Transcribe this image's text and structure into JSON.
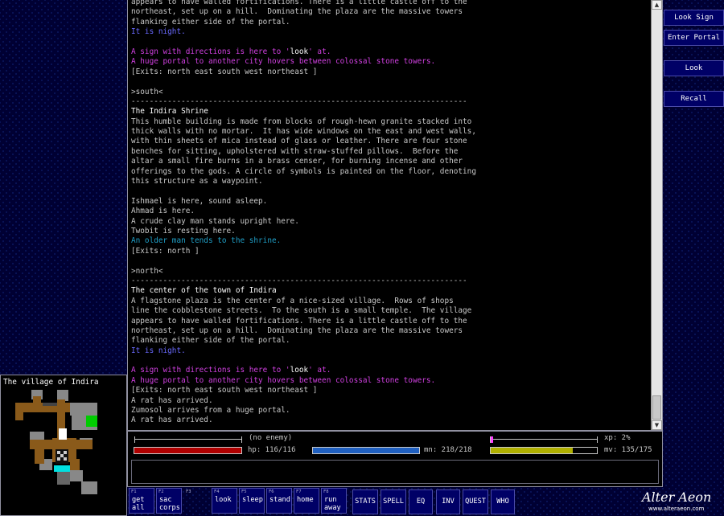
{
  "colors": {
    "text": "#c8c8c8",
    "title": "#ffffff",
    "night": "#6a6aff",
    "magenta": "#d040e0",
    "cyan": "#20a0c8",
    "command_highlight": "#ffffff",
    "hp": "#b00000",
    "mn": "#2060c0",
    "mv": "#b0b000",
    "xp": "#ff40ff"
  },
  "output_lines": [
    {
      "parts": [
        {
          "t": "appears to have walled fortifications. There is a little castle off to the",
          "c": "text"
        }
      ]
    },
    {
      "parts": [
        {
          "t": "northeast, set up on a hill.  Dominating the plaza are the massive towers",
          "c": "text"
        }
      ]
    },
    {
      "parts": [
        {
          "t": "flanking either side of the portal.",
          "c": "text"
        }
      ]
    },
    {
      "parts": [
        {
          "t": "It is night.",
          "c": "night"
        }
      ]
    },
    {
      "parts": [
        {
          "t": "",
          "c": "text"
        }
      ]
    },
    {
      "parts": [
        {
          "t": "A sign with directions is here to '",
          "c": "magenta"
        },
        {
          "t": "look",
          "c": "command_highlight"
        },
        {
          "t": "' at.",
          "c": "magenta"
        }
      ]
    },
    {
      "parts": [
        {
          "t": "A huge portal to another city hovers between colossal stone towers.",
          "c": "magenta"
        }
      ]
    },
    {
      "parts": [
        {
          "t": "[Exits: north east south west northeast ]",
          "c": "text"
        }
      ]
    },
    {
      "parts": [
        {
          "t": "",
          "c": "text"
        }
      ]
    },
    {
      "parts": [
        {
          "t": ">south<",
          "c": "text"
        }
      ]
    },
    {
      "parts": [
        {
          "t": "--------------------------------------------------------------------------",
          "c": "text"
        }
      ]
    },
    {
      "parts": [
        {
          "t": "The Indira Shrine",
          "c": "title"
        }
      ]
    },
    {
      "parts": [
        {
          "t": "This humble building is made from blocks of rough-hewn granite stacked into",
          "c": "text"
        }
      ]
    },
    {
      "parts": [
        {
          "t": "thick walls with no mortar.  It has wide windows on the east and west walls,",
          "c": "text"
        }
      ]
    },
    {
      "parts": [
        {
          "t": "with thin sheets of mica instead of glass or leather. There are four stone",
          "c": "text"
        }
      ]
    },
    {
      "parts": [
        {
          "t": "benches for sitting, upholstered with straw-stuffed pillows.  Before the",
          "c": "text"
        }
      ]
    },
    {
      "parts": [
        {
          "t": "altar a small fire burns in a brass censer, for burning incense and other",
          "c": "text"
        }
      ]
    },
    {
      "parts": [
        {
          "t": "offerings to the gods. A circle of symbols is painted on the floor, denoting",
          "c": "text"
        }
      ]
    },
    {
      "parts": [
        {
          "t": "this structure as a waypoint.",
          "c": "text"
        }
      ]
    },
    {
      "parts": [
        {
          "t": "",
          "c": "text"
        }
      ]
    },
    {
      "parts": [
        {
          "t": "Ishmael is here, sound asleep.",
          "c": "text"
        }
      ]
    },
    {
      "parts": [
        {
          "t": "Ahmad is here.",
          "c": "text"
        }
      ]
    },
    {
      "parts": [
        {
          "t": "A crude clay man stands upright here.",
          "c": "text"
        }
      ]
    },
    {
      "parts": [
        {
          "t": "Twobit is resting here.",
          "c": "text"
        }
      ]
    },
    {
      "parts": [
        {
          "t": "An older man tends to the shrine.",
          "c": "cyan"
        }
      ]
    },
    {
      "parts": [
        {
          "t": "[Exits: north ]",
          "c": "text"
        }
      ]
    },
    {
      "parts": [
        {
          "t": "",
          "c": "text"
        }
      ]
    },
    {
      "parts": [
        {
          "t": ">north<",
          "c": "text"
        }
      ]
    },
    {
      "parts": [
        {
          "t": "--------------------------------------------------------------------------",
          "c": "text"
        }
      ]
    },
    {
      "parts": [
        {
          "t": "The center of the town of Indira",
          "c": "title"
        }
      ]
    },
    {
      "parts": [
        {
          "t": "A flagstone plaza is the center of a nice-sized village.  Rows of shops",
          "c": "text"
        }
      ]
    },
    {
      "parts": [
        {
          "t": "line the cobblestone streets.  To the south is a small temple.  The village",
          "c": "text"
        }
      ]
    },
    {
      "parts": [
        {
          "t": "appears to have walled fortifications. There is a little castle off to the",
          "c": "text"
        }
      ]
    },
    {
      "parts": [
        {
          "t": "northeast, set up on a hill.  Dominating the plaza are the massive towers",
          "c": "text"
        }
      ]
    },
    {
      "parts": [
        {
          "t": "flanking either side of the portal.",
          "c": "text"
        }
      ]
    },
    {
      "parts": [
        {
          "t": "It is night.",
          "c": "night"
        }
      ]
    },
    {
      "parts": [
        {
          "t": "",
          "c": "text"
        }
      ]
    },
    {
      "parts": [
        {
          "t": "A sign with directions is here to '",
          "c": "magenta"
        },
        {
          "t": "look",
          "c": "command_highlight"
        },
        {
          "t": "' at.",
          "c": "magenta"
        }
      ]
    },
    {
      "parts": [
        {
          "t": "A huge portal to another city hovers between colossal stone towers.",
          "c": "magenta"
        }
      ]
    },
    {
      "parts": [
        {
          "t": "[Exits: north east south west northeast ]",
          "c": "text"
        }
      ]
    },
    {
      "parts": [
        {
          "t": "A rat has arrived.",
          "c": "text"
        }
      ]
    },
    {
      "parts": [
        {
          "t": "Zumosol arrives from a huge portal.",
          "c": "text"
        }
      ]
    },
    {
      "parts": [
        {
          "t": "A rat has arrived.",
          "c": "text"
        }
      ]
    }
  ],
  "side_buttons": [
    {
      "label": "Look Sign"
    },
    {
      "label": "Enter Portal"
    },
    {
      "label": "Look"
    },
    {
      "label": "Recall"
    }
  ],
  "status": {
    "enemy": "(no enemy)",
    "xp_label": "xp: 2%",
    "xp_fraction": 0.02,
    "hp_label": "hp: 116/116",
    "hp_fraction": 1.0,
    "mn_label": "mn: 218/218",
    "mn_fraction": 1.0,
    "mv_label": "mv: 135/175",
    "mv_fraction": 0.77
  },
  "map": {
    "title": "The village of Indira"
  },
  "fkeys": [
    {
      "num": "F1",
      "label": "get\nall"
    },
    {
      "num": "F2",
      "label": "sac\ncorps"
    },
    {
      "num": "F3",
      "label": ""
    },
    {
      "num": "F4",
      "label": "look"
    },
    {
      "num": "F5",
      "label": "sleep"
    },
    {
      "num": "F6",
      "label": "stand"
    },
    {
      "num": "F7",
      "label": "home"
    },
    {
      "num": "F8",
      "label": "run\naway"
    }
  ],
  "action_buttons": [
    {
      "label": "STATS"
    },
    {
      "label": "SPELL"
    },
    {
      "label": "EQ"
    },
    {
      "label": "INV"
    },
    {
      "label": "QUEST"
    },
    {
      "label": "WHO"
    }
  ],
  "branding": {
    "logo": "Alter Aeon",
    "url": "www.alteraeon.com"
  }
}
